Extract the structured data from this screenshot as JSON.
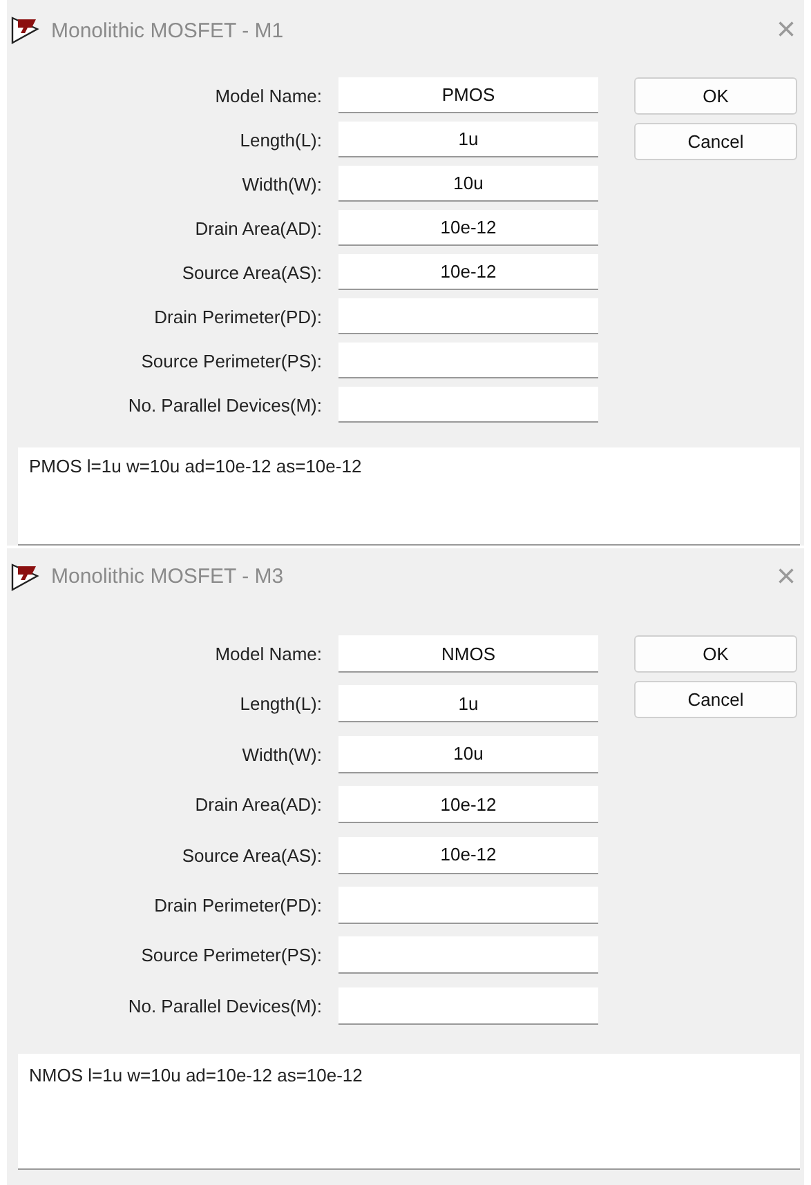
{
  "dialogs": [
    {
      "title": "Monolithic MOSFET - M1",
      "close": "×",
      "fields": [
        {
          "label": "Model Name:",
          "value": "PMOS"
        },
        {
          "label": "Length(L):",
          "value": "1u"
        },
        {
          "label": "Width(W):",
          "value": "10u"
        },
        {
          "label": "Drain Area(AD):",
          "value": "10e-12"
        },
        {
          "label": "Source Area(AS):",
          "value": "10e-12"
        },
        {
          "label": "Drain Perimeter(PD):"
        },
        {
          "label": "Source Perimeter(PS):"
        },
        {
          "label": "No. Parallel Devices(M):"
        }
      ],
      "buttons": [
        "OK",
        "Cancel"
      ],
      "preview": "PMOS l=1u w=10u ad=10e-12 as=10e-12"
    },
    {
      "title": "Monolithic MOSFET - M3",
      "close": "×",
      "fields": [
        {
          "label": "Model Name:",
          "value": "NMOS"
        },
        {
          "label": "Length(L):",
          "value": "1u"
        },
        {
          "label": "Width(W):",
          "value": "10u"
        },
        {
          "label": "Drain Area(AD):",
          "value": "10e-12"
        },
        {
          "label": "Source Area(AS):",
          "value": "10e-12"
        },
        {
          "label": "Drain Perimeter(PD):"
        },
        {
          "label": "Source Perimeter(PS):"
        },
        {
          "label": "No. Parallel Devices(M):"
        }
      ],
      "buttons": [
        "OK",
        "Cancel"
      ],
      "preview": "NMOS l=1u w=10u ad=10e-12 as=10e-12"
    }
  ]
}
